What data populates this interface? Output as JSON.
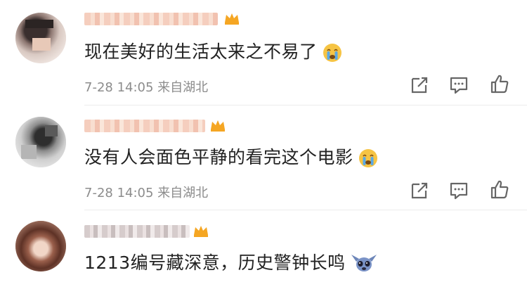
{
  "comments": [
    {
      "text": "现在美好的生活太来之不易了",
      "emoji": "crying-face",
      "meta": "7-28 14:05 来自湖北"
    },
    {
      "text": "没有人会面色平静的看完这个电影",
      "emoji": "crying-face",
      "meta": "7-28 14:05 来自湖北"
    },
    {
      "text": "1213编号藏深意，历史警钟长鸣",
      "emoji": "stitch-sticker"
    }
  ],
  "icons": {
    "share": "share-icon",
    "reply": "comment-icon",
    "like": "thumb-up-icon",
    "badge": "crown-icon"
  },
  "colors": {
    "text": "#222222",
    "meta": "#8c8c8c",
    "icon": "#666666",
    "crown": "#f5a623",
    "emoji_face": "#f6c444",
    "emoji_tear": "#5aa9e6"
  }
}
